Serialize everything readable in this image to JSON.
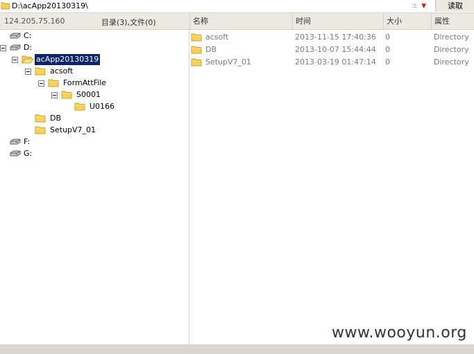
{
  "path_bar": {
    "path": "D:\\acApp20130319\\",
    "dropdown_glyph": "±",
    "read_button": "读取"
  },
  "header": {
    "ip": "124.205.75.160",
    "counts": "目录(3),文件(0)",
    "columns": [
      "名称",
      "时间",
      "大小",
      "属性"
    ]
  },
  "tree": {
    "drive_c": "C:",
    "drive_d": "D:",
    "acapp": "acApp20130319",
    "acsoft": "acsoft",
    "formattfile": "FormAttFile",
    "s0001": "S0001",
    "u0166": "U0166",
    "db": "DB",
    "setup": "SetupV7_01",
    "drive_f": "F:",
    "drive_g": "G:"
  },
  "files": [
    {
      "name": "acsoft",
      "time": "2013-11-15 17:40:36",
      "size": "0",
      "attr": "Directory"
    },
    {
      "name": "DB",
      "time": "2013-10-07 15:44:44",
      "size": "0",
      "attr": "Directory"
    },
    {
      "name": "SetupV7_01",
      "time": "2013-03-19 01:47:14",
      "size": "0",
      "attr": "Directory"
    }
  ],
  "watermark": "www.wooyun.org",
  "colors": {
    "selection": "#0a246a",
    "folder": "#f7d25a",
    "folder_stroke": "#c9a22a",
    "header_bg": "#ece9e3"
  },
  "icons": {
    "drive": "drive-icon",
    "folder": "folder-icon",
    "open_folder": "folder-open-icon"
  }
}
